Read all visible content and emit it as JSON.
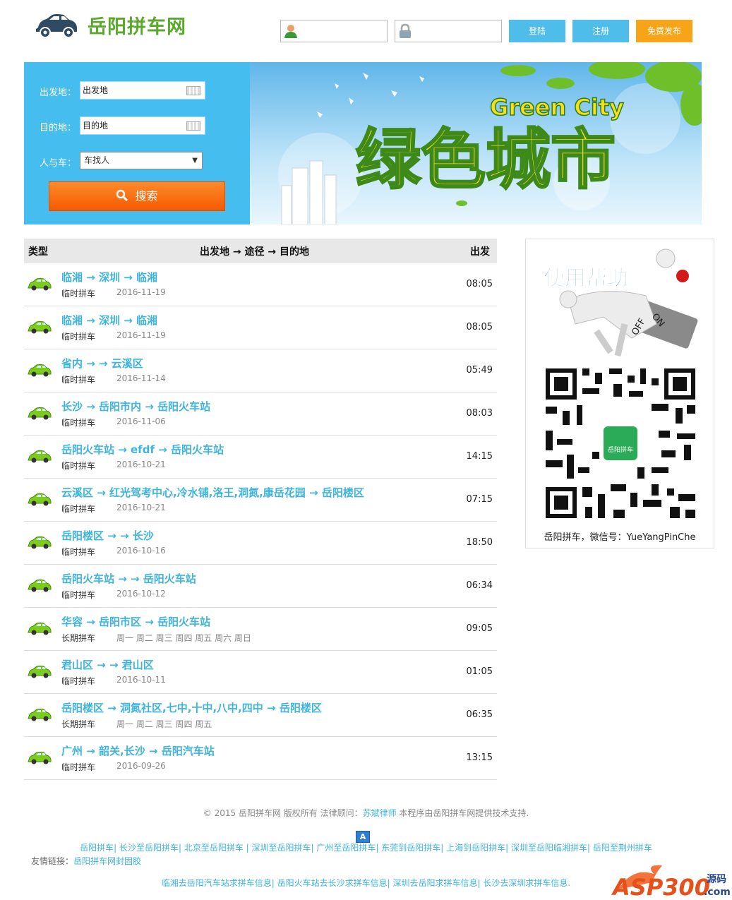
{
  "header": {
    "site_name": "岳阳拼车网",
    "login_button": "登陆",
    "register_button": "注册",
    "publish_button": "免费发布",
    "username_value": "",
    "password_value": ""
  },
  "search": {
    "from_label": "出发地：",
    "from_value": "出发地",
    "to_label": "目的地：",
    "to_value": "目的地",
    "type_label": "人与车：",
    "type_selected": "车找人",
    "search_button": "搜索"
  },
  "banner": {
    "title_cn": "绿色城市",
    "title_en": "Green City"
  },
  "list": {
    "headers": [
      "类型",
      "出发地 → 途径 → 目的地",
      "出发"
    ],
    "rows": [
      {
        "route": "临湘 → 深圳 → 临湘",
        "kind": "临时拼车",
        "date": "2016-11-19",
        "time": "08:05"
      },
      {
        "route": "临湘 → 深圳 → 临湘",
        "kind": "临时拼车",
        "date": "2016-11-19",
        "time": "08:05"
      },
      {
        "route": "省内 → → 云溪区",
        "kind": "临时拼车",
        "date": "2016-11-14",
        "time": "05:49"
      },
      {
        "route": "长沙 → 岳阳市内 → 岳阳火车站",
        "kind": "临时拼车",
        "date": "2016-11-06",
        "time": "08:03"
      },
      {
        "route": "岳阳火车站 → efdf → 岳阳火车站",
        "kind": "临时拼车",
        "date": "2016-10-21",
        "time": "14:15"
      },
      {
        "route": "云溪区 → 红光驾考中心,冷水铺,洛王,洞氮,康岳花园 → 岳阳楼区",
        "kind": "临时拼车",
        "date": "2016-10-21",
        "time": "07:15"
      },
      {
        "route": "岳阳楼区 → → 长沙",
        "kind": "临时拼车",
        "date": "2016-10-16",
        "time": "18:50"
      },
      {
        "route": "岳阳火车站 → → 岳阳火车站",
        "kind": "临时拼车",
        "date": "2016-10-12",
        "time": "06:34"
      },
      {
        "route": "华容 → 岳阳市区 → 岳阳火车站",
        "kind": "长期拼车",
        "date": "周一  周二  周三  周四  周五  周六  周日",
        "time": "09:05"
      },
      {
        "route": "君山区 → → 君山区",
        "kind": "临时拼车",
        "date": "2016-10-11",
        "time": "01:05"
      },
      {
        "route": "岳阳楼区 → 洞氮社区,七中,十中,八中,四中 → 岳阳楼区",
        "kind": "长期拼车",
        "date": "周一  周二  周三  周四  周五",
        "time": "06:35"
      },
      {
        "route": "广州 → 韶关,长沙 → 岳阳汽车站",
        "kind": "临时拼车",
        "date": "2016-09-26",
        "time": "13:15"
      }
    ]
  },
  "help": {
    "title": "使用帮助",
    "switch_on": "ON",
    "switch_off": "OFF",
    "qr_badge": "岳阳拼车",
    "qr_caption": "岳阳拼车，微信号：YueYangPinChe"
  },
  "footer": {
    "copyright_pre": "© 2015 岳阳拼车网 版权所有 法律顾问：",
    "lawyer": "苏斌律师",
    "copyright_post": " 本程序由岳阳拼车网提供技术支持.",
    "links": "岳阳拼车| 长沙至岳阳拼车| 北京至岳阳拼车 | 深圳至岳阳拼车| 广州至岳阳拼车| 东莞到岳阳拼车| 上海到岳阳拼车| 深圳至岳阳临湘拼车| 岳阳至荆州拼车",
    "friend_label": "友情链接：",
    "friend_link": "岳阳拼车网封固胶",
    "links2": "临湘去岳阳汽车站求拼车信息| 岳阳火车站去长沙求拼车信息| 深圳去岳阳求拼车信息| 长沙去深圳求拼车信息.",
    "watermark_main": "ASP300",
    "watermark_sub1": "源码",
    "watermark_sub2": ".com"
  },
  "colors": {
    "accent_blue": "#45bdee",
    "link_blue": "#3eb4dc",
    "orange": "#f8a418",
    "green": "#5aa82c"
  }
}
